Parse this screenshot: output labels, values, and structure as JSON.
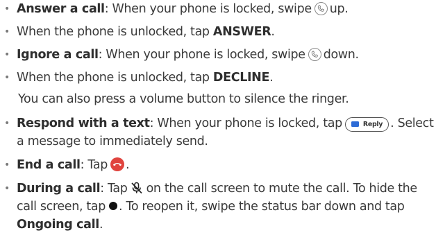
{
  "bullet_char": "•",
  "items": [
    {
      "bold": "Answer a call",
      "text1": ": When your phone is locked, swipe",
      "text2": "up."
    },
    {
      "text1": "When the phone is unlocked, tap",
      "bold": "ANSWER",
      "text2": "."
    },
    {
      "bold": "Ignore a call",
      "text1": ": When your phone is locked, swipe",
      "text2": "down."
    },
    {
      "text1": "When the phone is unlocked, tap",
      "bold": "DECLINE",
      "text2": "."
    },
    {
      "text1": "You can also press a volume button to silence the ringer."
    },
    {
      "bold": "Respond with a text",
      "text1": ": When your phone is locked, tap",
      "text2": ". Select",
      "line2": "a message to immediately send."
    },
    {
      "bold": "End a call",
      "text1": ": Tap",
      "text2": "."
    },
    {
      "bold": "During a call",
      "text1": ": Tap",
      "text2": "on the call screen to mute the call. To hide the",
      "line2a": "call screen, tap",
      "line2b": ". To reopen it, swipe the status bar down and tap",
      "bold2": "Ongoing call",
      "text3": "."
    }
  ],
  "reply_button_label": "Reply",
  "icons": {
    "answer": "phone-icon",
    "ignore": "phone-icon",
    "reply": "message-icon",
    "end": "end-call-icon",
    "mute": "mute-microphone-icon",
    "hide": "filled-circle-icon"
  },
  "colors": {
    "text": "#3a3a3a",
    "end_call": "#e0443e",
    "message_icon": "#2d6bd6"
  }
}
